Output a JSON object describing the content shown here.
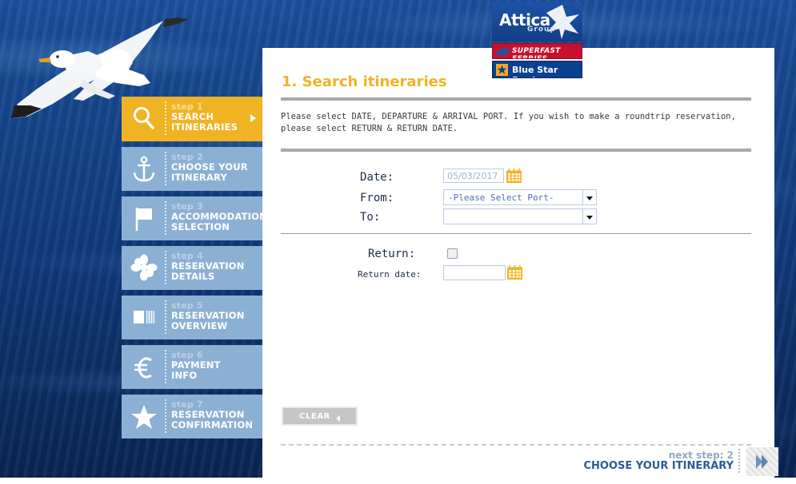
{
  "brand": {
    "attica_name": "Attica",
    "attica_group": "Group",
    "superfast": "SUPERFAST FERRIES",
    "bluestar": "Blue Star Ferries",
    "accent_gold": "#f0b323",
    "accent_blue": "#1d53a6",
    "step_idle_blue": "#8cb0d4"
  },
  "sidebar": {
    "items": [
      {
        "num": "step 1",
        "line1": "SEARCH",
        "line2": "ITINERARIES",
        "icon": "magnifier-icon",
        "active": true
      },
      {
        "num": "step 2",
        "line1": "CHOOSE YOUR",
        "line2": "ITINERARY",
        "icon": "anchor-icon",
        "active": false
      },
      {
        "num": "step 3",
        "line1": "ACCOMMODATION",
        "line2": "SELECTION",
        "icon": "flag-icon",
        "active": false
      },
      {
        "num": "step 4",
        "line1": "RESERVATION",
        "line2": "DETAILS",
        "icon": "flower-icon",
        "active": false
      },
      {
        "num": "step 5",
        "line1": "RESERVATION",
        "line2": "OVERVIEW",
        "icon": "ticket-icon",
        "active": false
      },
      {
        "num": "step 6",
        "line1": "PAYMENT",
        "line2": "INFO",
        "icon": "euro-icon",
        "active": false
      },
      {
        "num": "step 7",
        "line1": "RESERVATION",
        "line2": "CONFIRMATION",
        "icon": "star-icon",
        "active": false
      }
    ]
  },
  "main": {
    "title": "1. Search itineraries",
    "intro_line1": "Please select DATE, DEPARTURE & ARRIVAL PORT. If you wish to make a roundtrip reservation,",
    "intro_line2": "please select RETURN & RETURN DATE.",
    "form": {
      "date_label": "Date:",
      "date_value": "05/03/2017",
      "from_label": "From:",
      "from_value": "-Please Select Port-",
      "to_label": "To:",
      "to_value": "",
      "return_label": "Return:",
      "return_checked": false,
      "return_date_label": "Return date:",
      "return_date_value": "",
      "calendar_icon": "calendar-icon"
    },
    "clear_label": "CLEAR"
  },
  "footer": {
    "next_sub": "next step: 2",
    "next_main": "CHOOSE YOUR ITINERARY",
    "next_icon": "double-chevron-right-icon"
  }
}
